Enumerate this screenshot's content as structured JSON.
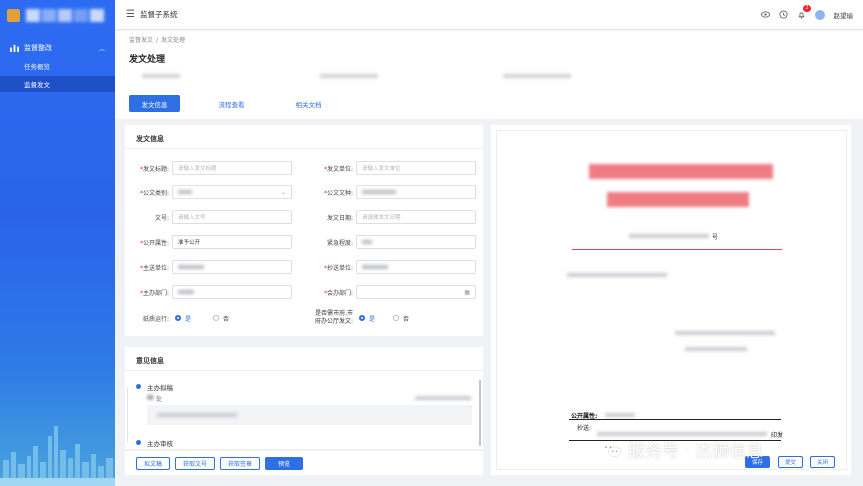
{
  "app": {
    "system_title": "监督子系统",
    "user_name": "赵望瑜",
    "notification_count": "2"
  },
  "sidebar": {
    "group_label": "监督整改",
    "items": [
      {
        "label": "任务概览",
        "active": false
      },
      {
        "label": "监督发文",
        "active": true
      }
    ]
  },
  "breadcrumb": {
    "parent": "监督发文",
    "separator": "/",
    "current": "发文处理"
  },
  "page": {
    "title": "发文处理"
  },
  "tabs": [
    {
      "label": "发文信息",
      "active": true
    },
    {
      "label": "流程查看",
      "active": false
    },
    {
      "label": "相关文档",
      "active": false
    }
  ],
  "form": {
    "section_title": "发文信息",
    "fields": {
      "title": {
        "label": "发文标题:",
        "placeholder": "请输入发文标题",
        "required": true
      },
      "issuer": {
        "label": "发文单位:",
        "placeholder": "请输入发文单位",
        "required": true
      },
      "doc_category": {
        "label": "公文类别:",
        "required": true
      },
      "doc_type": {
        "label": "公文文种:",
        "required": true
      },
      "doc_number": {
        "label": "文号:",
        "placeholder": "请输入文号",
        "required": false
      },
      "issue_date": {
        "label": "发文日期:",
        "placeholder": "请选择发文日期",
        "required": false
      },
      "disclosure": {
        "label": "公开属性:",
        "value": "准予公开",
        "required": true
      },
      "urgency": {
        "label": "紧急程度:",
        "required": false
      },
      "main_recipient": {
        "label": "主送单位:",
        "required": true
      },
      "cc_unit": {
        "label": "抄送单位:",
        "required": true
      },
      "host_dept": {
        "label": "主办部门:",
        "required": true
      },
      "co_dept": {
        "label": "会办部门:",
        "required": true
      },
      "paper_run": {
        "label": "纸质运行:",
        "options": [
          "是",
          "否"
        ],
        "selected": "是"
      },
      "joint_release": {
        "label_line1": "是否需市府,市",
        "label_line2": "府办公厅发文:",
        "options": [
          "是",
          "否"
        ],
        "selected": "是"
      }
    }
  },
  "opinions": {
    "section_title": "意见信息",
    "items": [
      {
        "name": "主办拟稿",
        "dept_suffix": "处"
      },
      {
        "name": "主办审核"
      }
    ]
  },
  "actions": {
    "draft": "拟文稿",
    "get_number": "获取文号",
    "get_seal": "获取签章",
    "preview": "预览"
  },
  "preview": {
    "doc_number_suffix": "号",
    "disclosure_label": "公开属性:",
    "cc_label": "抄送:",
    "issued_suffix": "印发",
    "buttons": {
      "save": "保存",
      "submit": "提交",
      "close": "关闭"
    }
  },
  "watermark": {
    "text": "服务号 · 杰狮信息"
  },
  "colors": {
    "primary": "#2f6fe4",
    "required": "#f5222d",
    "red_header": "#f07c83"
  }
}
